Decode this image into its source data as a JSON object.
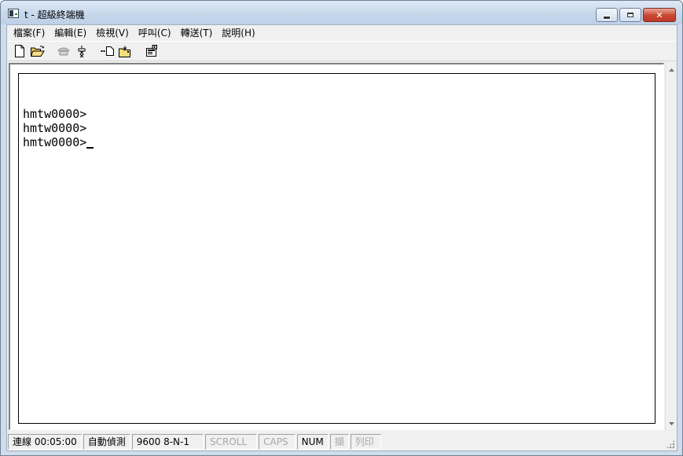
{
  "window": {
    "title": "t - 超級終端機",
    "caption_buttons": {
      "minimize": "minimize",
      "maximize": "maximize",
      "close": "✕"
    }
  },
  "menu": [
    {
      "label": "檔案(F)"
    },
    {
      "label": "編輯(E)"
    },
    {
      "label": "檢視(V)"
    },
    {
      "label": "呼叫(C)"
    },
    {
      "label": "轉送(T)"
    },
    {
      "label": "說明(H)"
    }
  ],
  "toolbar": {
    "icons": [
      "new-document-icon",
      "open-folder-icon",
      "call-icon",
      "disconnect-icon",
      "send-file-icon",
      "receive-file-icon",
      "properties-icon"
    ]
  },
  "terminal": {
    "lines": [
      "",
      "hmtw0000>",
      "hmtw0000>",
      "hmtw0000>"
    ]
  },
  "statusbar": {
    "connection": "連線 00:05:00",
    "detect": "自動偵測",
    "port_settings": "9600 8-N-1",
    "scroll": "SCROLL",
    "caps": "CAPS",
    "num": "NUM",
    "capture": "擷",
    "print": "列印"
  },
  "colors": {
    "title_bar": "#c9d9ec",
    "close_button": "#c8452f",
    "terminal_background": "#ffffff",
    "terminal_text": "#000000"
  }
}
